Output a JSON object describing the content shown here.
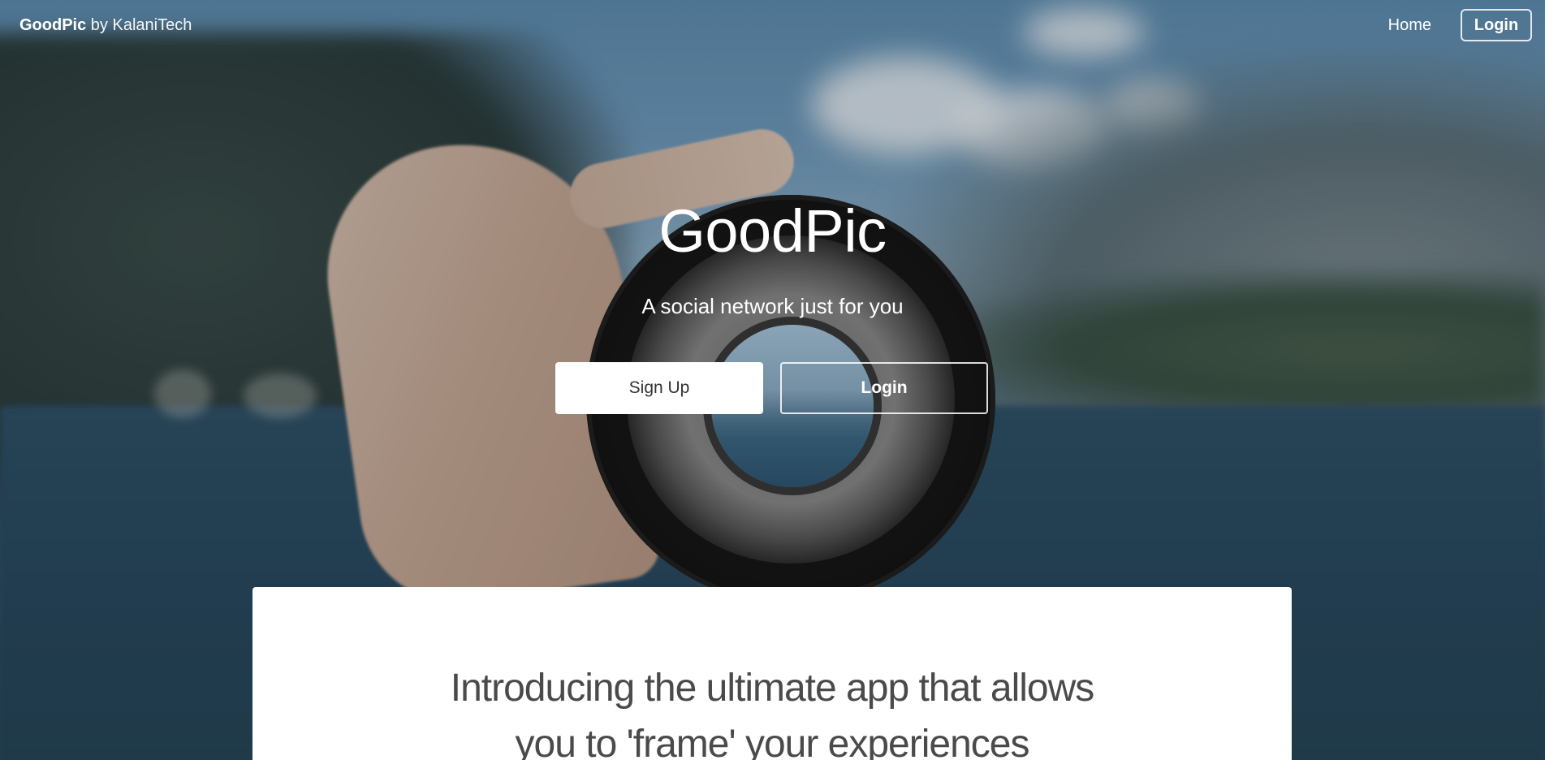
{
  "navbar": {
    "brand_name": "GoodPic",
    "brand_by": "by KalaniTech",
    "home_label": "Home",
    "login_label": "Login"
  },
  "hero": {
    "title": "GoodPic",
    "subtitle": "A social network just for you",
    "signup_label": "Sign Up",
    "login_label": "Login"
  },
  "content": {
    "intro_line1": "Introducing the ultimate app that allows",
    "intro_line2": "you to 'frame' your experiences"
  },
  "colors": {
    "text_on_hero": "#ffffff",
    "card_bg": "#ffffff",
    "card_text": "#4a4a4a"
  }
}
